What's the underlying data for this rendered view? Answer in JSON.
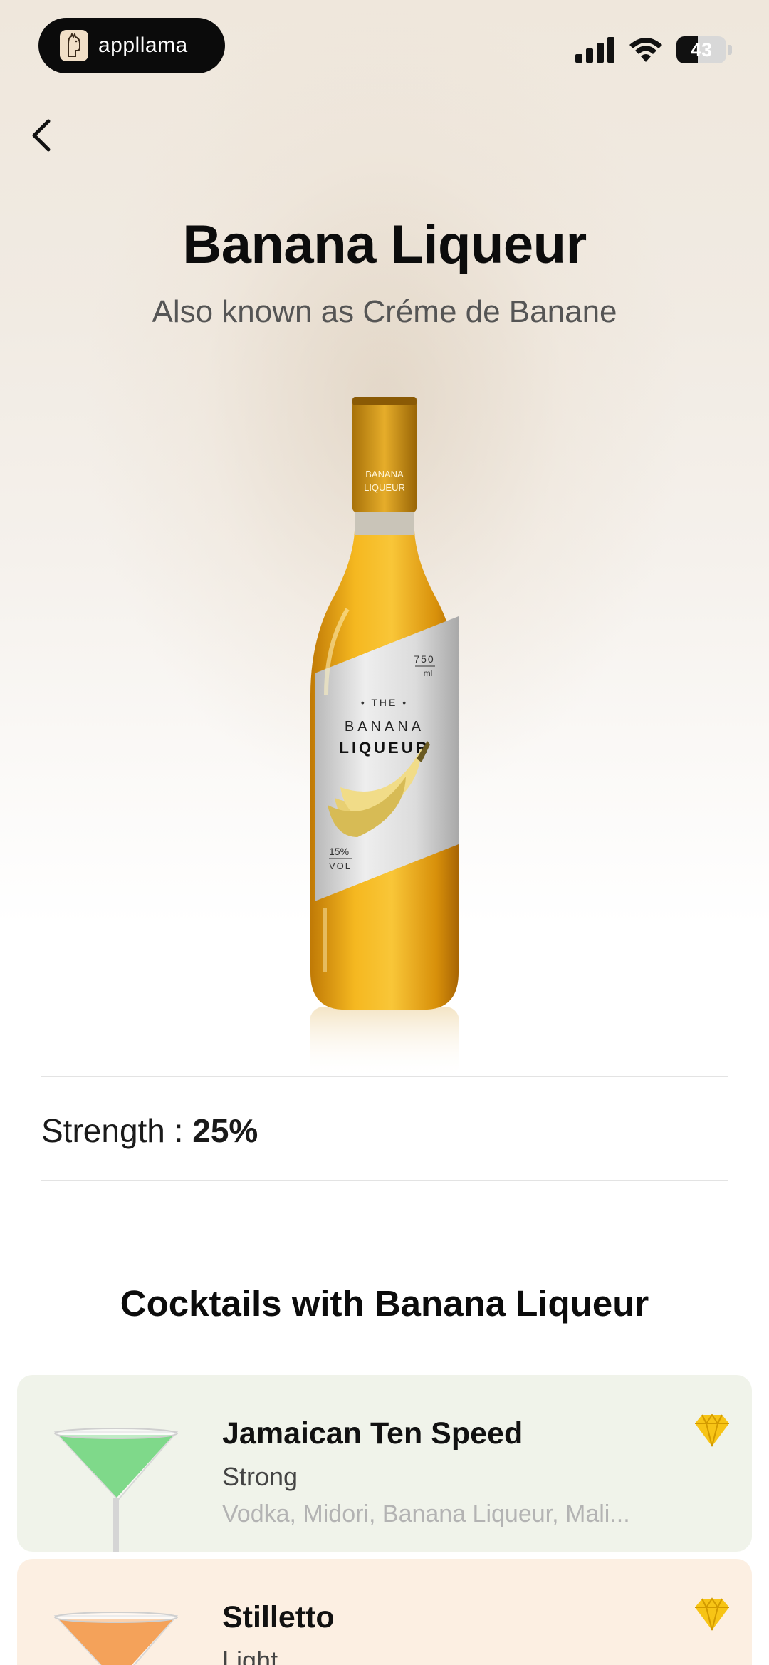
{
  "status_bar": {
    "app_name": "appllama",
    "battery_level": "43",
    "battery_fraction": 0.43
  },
  "header": {
    "title": "Banana Liqueur",
    "subtitle": "Also known as Créme de Banane"
  },
  "bottle": {
    "neck_label": [
      "BANANA",
      "LIQUEUR"
    ],
    "volume": "750",
    "volume_unit": "ml",
    "label_the": "• THE •",
    "label_line1": "BANANA",
    "label_line2": "LIQUEUR",
    "abv": "15%",
    "abv_unit": "VOL"
  },
  "strength": {
    "label": "Strength : ",
    "value": "25%"
  },
  "cocktails": {
    "section_title": "Cocktails with Banana Liqueur",
    "items": [
      {
        "name": "Jamaican Ten Speed",
        "strength": "Strong",
        "ingredients": "Vodka, Midori, Banana Liqueur, Mali...",
        "card_color": "#f0f3ea",
        "drink_color": "#7fd98a",
        "icon": "gem-icon"
      },
      {
        "name": "Stilletto",
        "strength": "Light",
        "ingredients": "",
        "card_color": "#fcefe2",
        "drink_color": "#f4a25a",
        "icon": "gem-icon"
      }
    ]
  },
  "colors": {
    "accent_gem": "#f7c416",
    "liqueur": "#e8a20e"
  }
}
